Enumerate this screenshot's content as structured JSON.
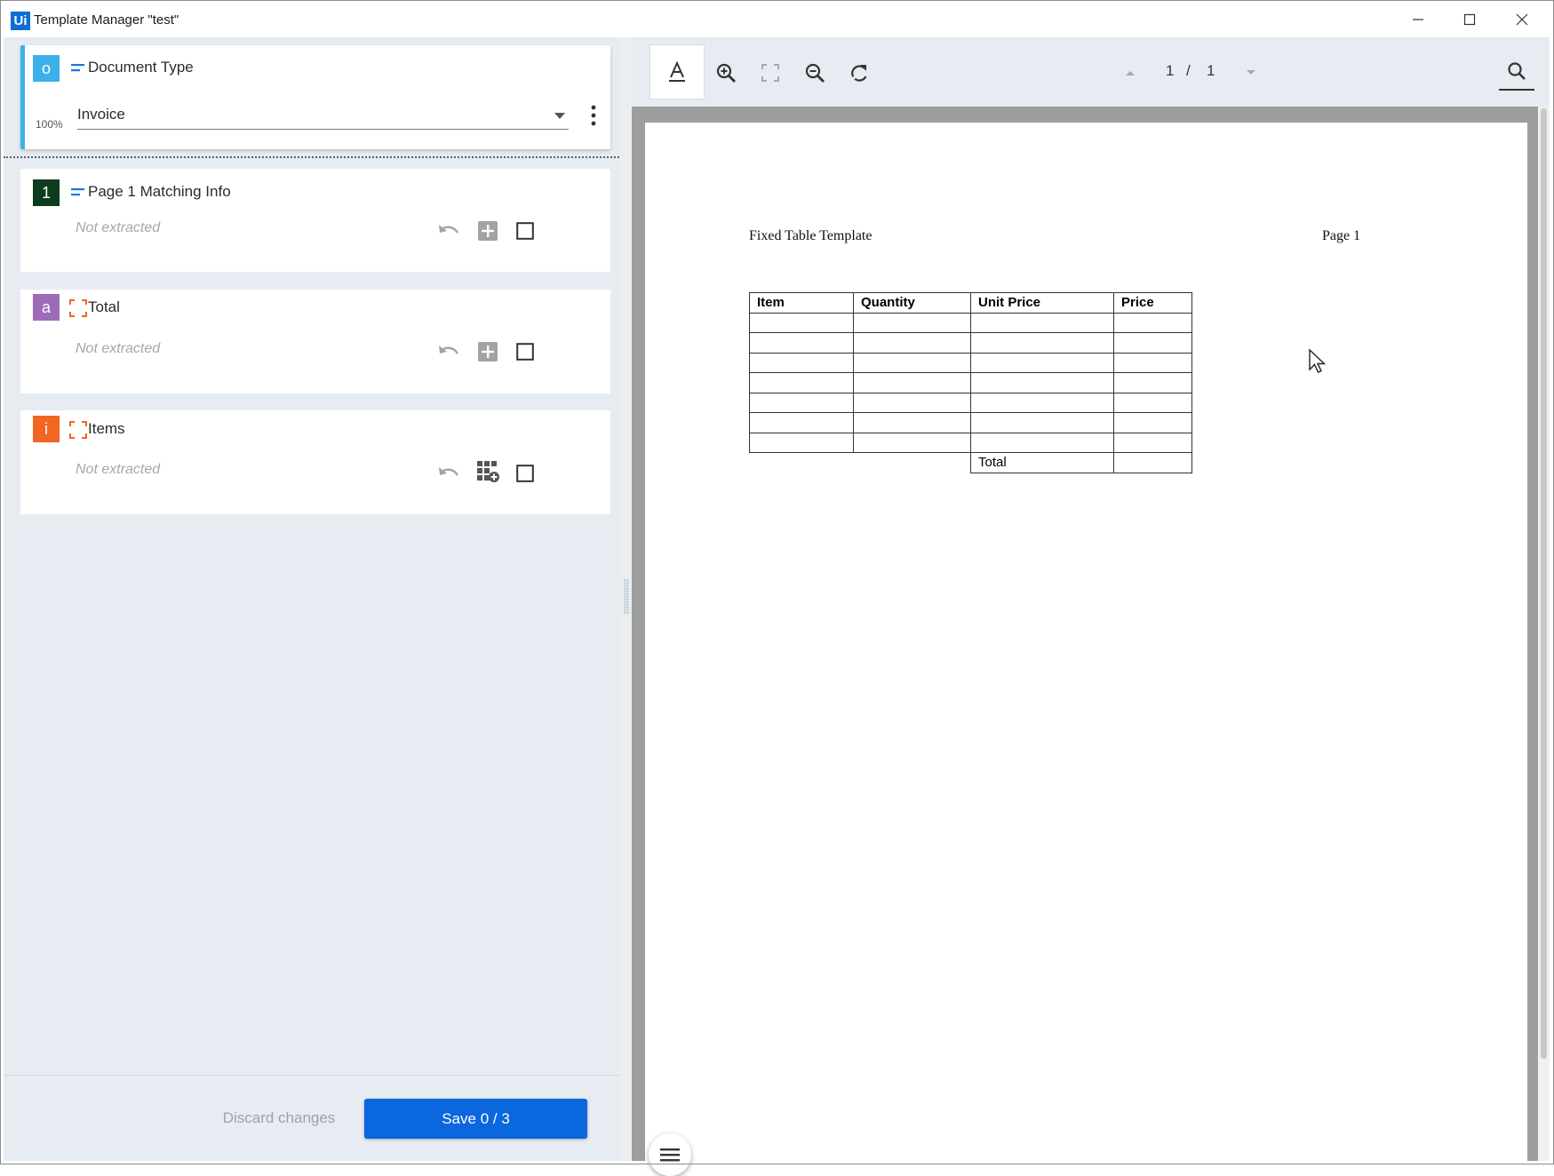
{
  "window": {
    "logo_text": "Ui",
    "title": "Template Manager \"test\"",
    "controls": [
      "minimize-icon",
      "maximize-icon",
      "close-icon"
    ]
  },
  "document_type_card": {
    "badge": "o",
    "badge_color": "#3cb1e9",
    "title": "Document Type",
    "confidence": "100%",
    "selected_type": "Invoice",
    "icon": "text-field-icon"
  },
  "fields": [
    {
      "badge": "1",
      "badge_color": "#0d3b1e",
      "icon": "text-field-icon",
      "title": "Page 1 Matching Info",
      "status": "Not extracted",
      "actions": [
        "undo-icon",
        "add-value-icon",
        "checkbox"
      ]
    },
    {
      "badge": "a",
      "badge_color": "#9d6bb8",
      "icon": "region-selection-icon",
      "title": "Total",
      "status": "Not extracted",
      "actions": [
        "undo-icon",
        "add-value-icon",
        "checkbox"
      ]
    },
    {
      "badge": "i",
      "badge_color": "#f26522",
      "icon": "region-selection-icon",
      "title": "Items",
      "status": "Not extracted",
      "actions": [
        "undo-icon",
        "add-table-icon",
        "checkbox"
      ]
    }
  ],
  "footer": {
    "discard_label": "Discard changes",
    "save_label": "Save 0 / 3",
    "accent": "#0a67de"
  },
  "viewer_toolbar": {
    "tools": [
      "text-selection-icon",
      "zoom-in-icon",
      "fit-page-icon",
      "zoom-out-icon",
      "rotate-icon"
    ],
    "current_page": "1",
    "page_separator": "/",
    "total_pages": "1",
    "search": "search-icon"
  },
  "document": {
    "heading": "Fixed Table Template",
    "page_label": "Page 1",
    "table_headers": [
      "Item",
      "Quantity",
      "Unit Price",
      "Price"
    ],
    "total_label": "Total"
  }
}
